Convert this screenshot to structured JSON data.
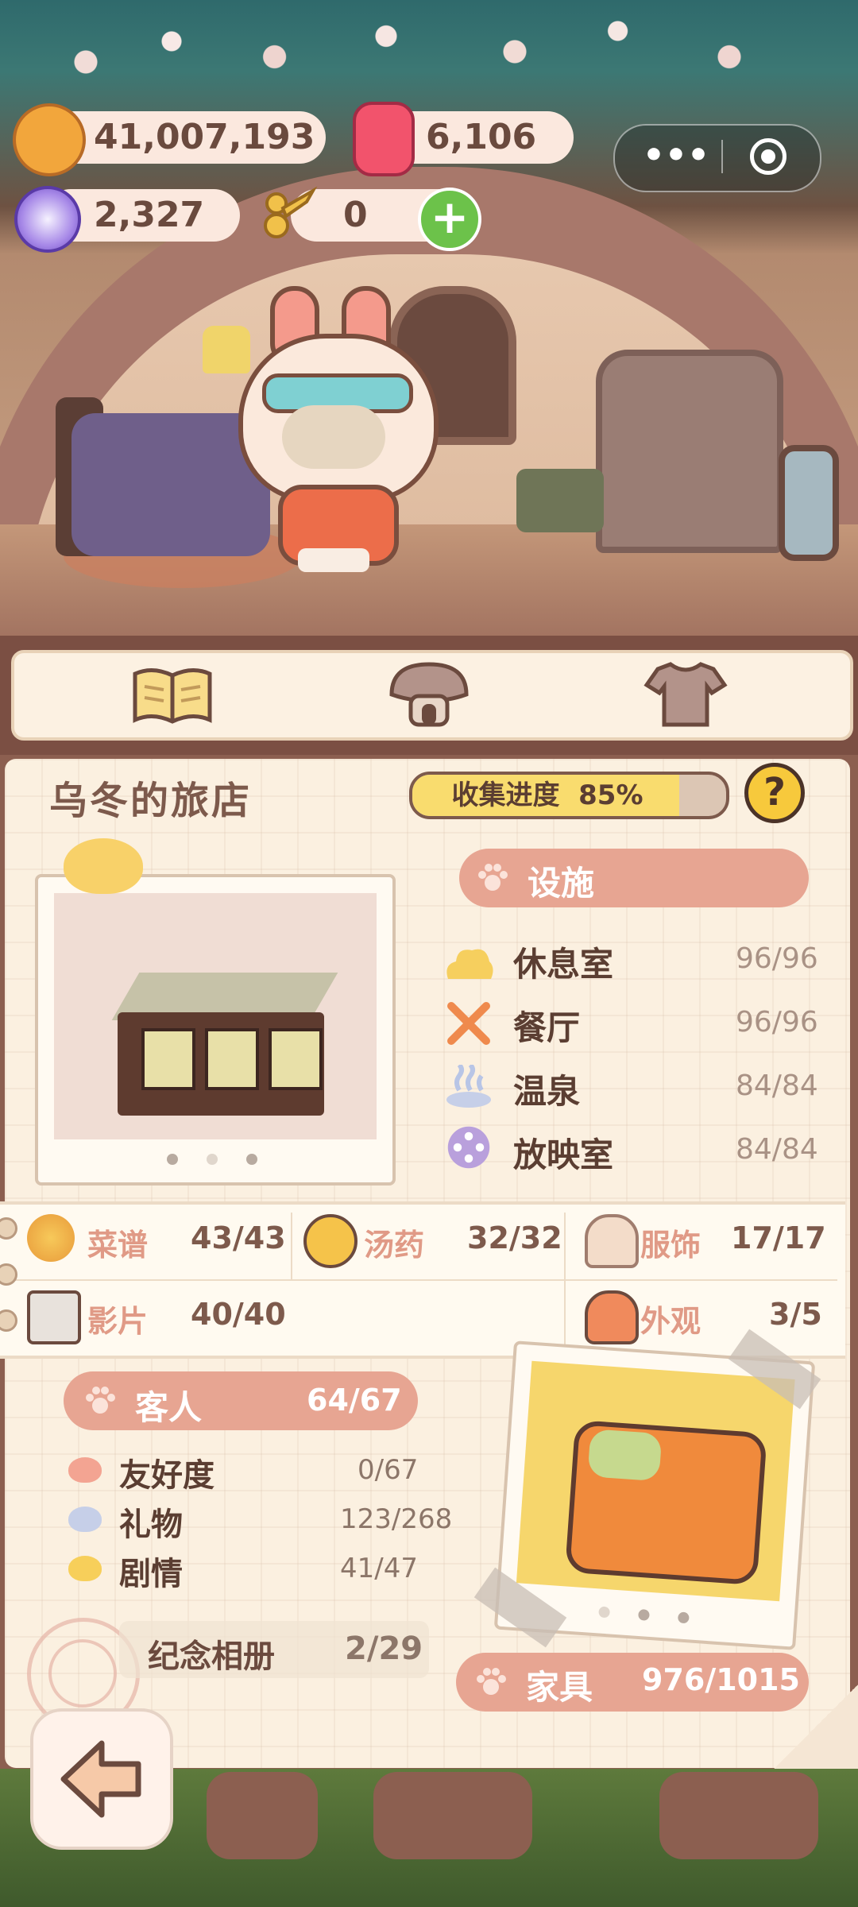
{
  "hud": {
    "coins": "41,007,193",
    "candy": "6,106",
    "gems": "2,327",
    "scissors": "0",
    "plus_label": "+",
    "capsule_dots": "•••"
  },
  "tabs": [
    {
      "name": "book-tab",
      "icon": "open-book-icon"
    },
    {
      "name": "hotel-tab",
      "icon": "mushroom-hotel-icon"
    },
    {
      "name": "outfit-tab",
      "icon": "shirt-icon"
    }
  ],
  "panel": {
    "title": "乌冬的旅店",
    "progress_label": "收集进度",
    "progress_value": "85%",
    "progress_fraction": 0.85,
    "help_label": "?"
  },
  "facilities": {
    "header": "设施",
    "items": [
      {
        "label": "休息室",
        "value": "96/96",
        "icon": "cloud-icon",
        "color": "#f6cf5e"
      },
      {
        "label": "餐厅",
        "value": "96/96",
        "icon": "utensils-icon",
        "color": "#ef8a4d"
      },
      {
        "label": "温泉",
        "value": "84/84",
        "icon": "hot-spring-icon",
        "color": "#b8c5e6"
      },
      {
        "label": "放映室",
        "value": "84/84",
        "icon": "film-reel-icon",
        "color": "#b9a0dc"
      }
    ]
  },
  "categories": [
    {
      "label": "菜谱",
      "value": "43/43",
      "icon": "dish-icon"
    },
    {
      "label": "汤药",
      "value": "32/32",
      "icon": "potion-jar-icon"
    },
    {
      "label": "服饰",
      "value": "17/17",
      "icon": "outfit-figure-icon"
    },
    {
      "label": "影片",
      "value": "40/40",
      "icon": "clapperboard-icon"
    },
    {
      "label": "外观",
      "value": "3/5",
      "icon": "mushroom-house-icon"
    }
  ],
  "guests": {
    "header": "客人",
    "value": "64/67",
    "items": [
      {
        "label": "友好度",
        "value": "0/67",
        "color": "#f3a492"
      },
      {
        "label": "礼物",
        "value": "123/268",
        "color": "#c6cfe8"
      },
      {
        "label": "剧情",
        "value": "41/47",
        "color": "#f7cf5a"
      }
    ]
  },
  "album": {
    "label": "纪念相册",
    "value": "2/29"
  },
  "furniture": {
    "label": "家具",
    "value": "976/1015"
  },
  "colors": {
    "panel_brown": "#8c5f50",
    "paper": "#fbf0e0",
    "accent_pink": "#e7a592",
    "progress_yellow": "#f9dc6e"
  }
}
